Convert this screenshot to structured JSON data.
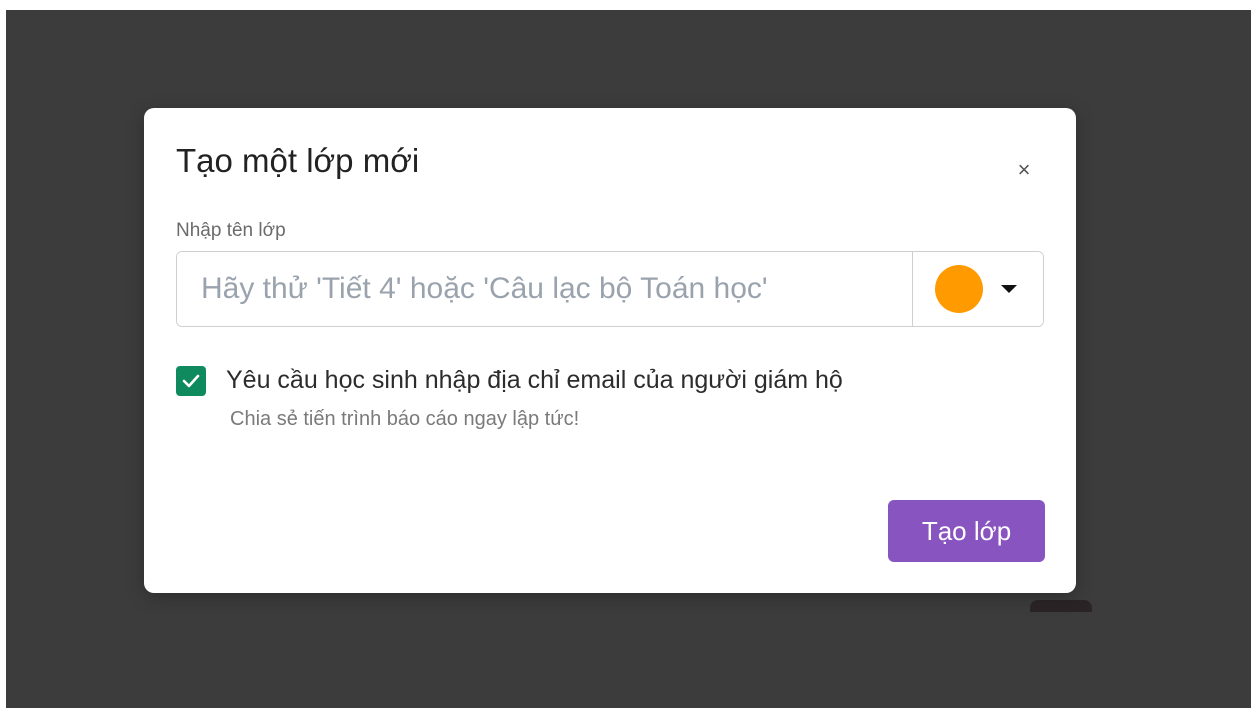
{
  "modal": {
    "title": "Tạo một lớp mới",
    "close_glyph": "×",
    "close_icon": "close-icon",
    "field_label": "Nhập tên lớp",
    "name_input": {
      "placeholder": "Hãy thử 'Tiết 4' hoặc 'Câu lạc bộ Toán học'",
      "value": ""
    },
    "color_picker": {
      "selected_color": "#FF9A00",
      "caret_icon": "caret-down-icon"
    },
    "guardian_email": {
      "checked": true,
      "label": "Yêu cầu học sinh nhập địa chỉ email của người giám hộ",
      "helper": "Chia sẻ tiến trình báo cáo ngay lập tức!"
    },
    "submit_label": "Tạo lớp"
  },
  "theme": {
    "overlay": "#3C3C3C",
    "checkbox_color": "#0F8A5F",
    "button_color": "#8854C0"
  }
}
